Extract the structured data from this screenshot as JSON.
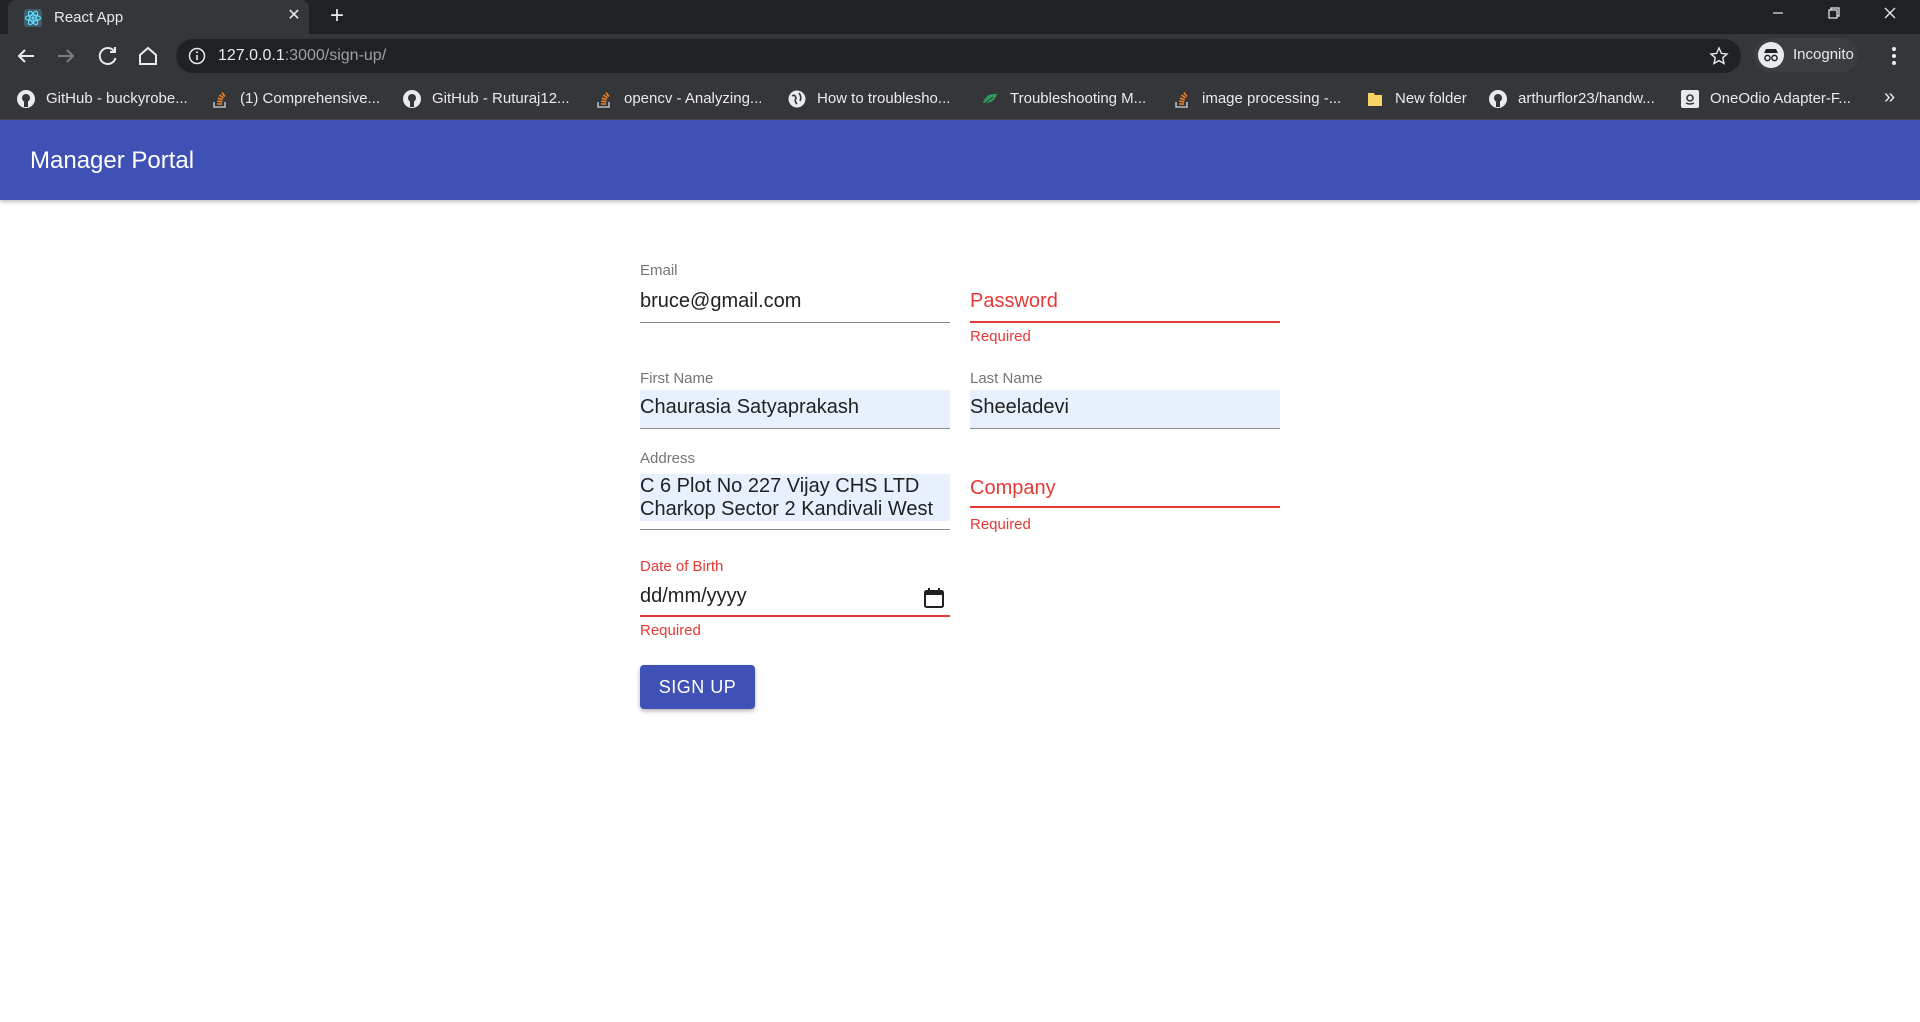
{
  "browser": {
    "tab_title": "React App",
    "tab_close": "✕",
    "new_tab": "+",
    "url_host": "127.0.0.1",
    "url_path": ":3000/sign-up/",
    "incognito_label": "Incognito",
    "bookmarks": [
      {
        "label": "GitHub - buckyrobe...",
        "icon": "github-icon"
      },
      {
        "label": "(1) Comprehensive...",
        "icon": "stackoverflow-icon"
      },
      {
        "label": "GitHub - Ruturaj12...",
        "icon": "github-icon"
      },
      {
        "label": "opencv - Analyzing...",
        "icon": "stackoverflow-icon"
      },
      {
        "label": "How to troublesho...",
        "icon": "globe-icon"
      },
      {
        "label": "Troubleshooting M...",
        "icon": "leaf-icon"
      },
      {
        "label": "image processing -...",
        "icon": "stackoverflow-icon"
      },
      {
        "label": "New folder",
        "icon": "folder-icon"
      },
      {
        "label": "arthurflor23/handw...",
        "icon": "github-icon"
      },
      {
        "label": "OneOdio Adapter-F...",
        "icon": "amazon-icon"
      }
    ],
    "bookmarks_more": "»"
  },
  "app": {
    "title": "Manager Portal",
    "form": {
      "email": {
        "label": "Email",
        "value": "bruce@gmail.com"
      },
      "password": {
        "placeholder": "Password",
        "helper": "Required"
      },
      "first_name": {
        "label": "First Name",
        "value": "Chaurasia Satyaprakash"
      },
      "last_name": {
        "label": "Last Name",
        "value": "Sheeladevi"
      },
      "address": {
        "label": "Address",
        "line1": "C 6 Plot No 227 Vijay CHS LTD",
        "line2": "Charkop Sector 2 Kandivali West"
      },
      "company": {
        "placeholder": "Company",
        "helper": "Required"
      },
      "dob": {
        "label": "Date of Birth",
        "value": "dd/mm/yyyy",
        "helper": "Required"
      },
      "submit_label": "SIGN UP"
    }
  },
  "colors": {
    "appbar": "#3f51b5",
    "error": "#e53935",
    "autofill": "#e8f0fe"
  }
}
